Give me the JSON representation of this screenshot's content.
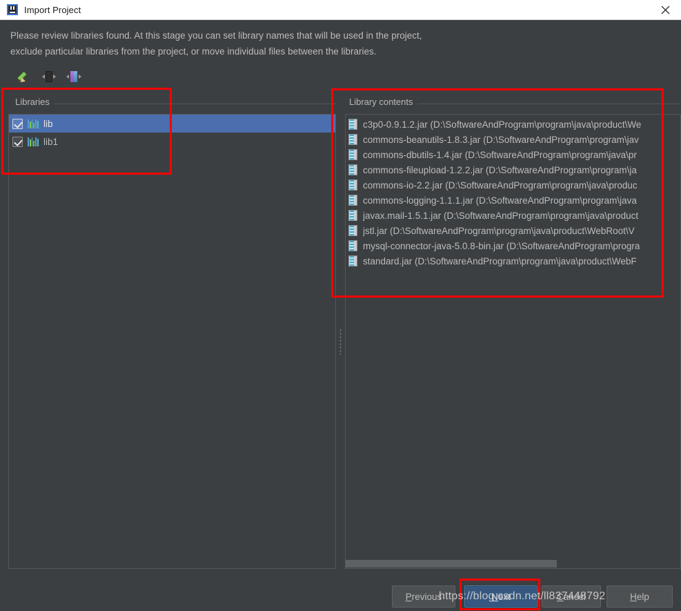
{
  "window": {
    "title": "Import Project",
    "icon": "intellij-idea-icon",
    "close_label": "✕"
  },
  "description": {
    "line1": "Please review libraries found. At this stage you can set library names that will be used in the project,",
    "line2": "exclude particular libraries from the project, or move individual files between the libraries."
  },
  "toolbar": {
    "items": [
      {
        "name": "rename-library-button",
        "icon": "pencil-icon"
      },
      {
        "name": "split-library-button",
        "icon": "split-icon"
      },
      {
        "name": "merge-libraries-button",
        "icon": "merge-icon"
      }
    ]
  },
  "libraries_panel": {
    "title": "Libraries",
    "items": [
      {
        "label": "lib",
        "checked": true,
        "selected": true
      },
      {
        "label": "lib1",
        "checked": true,
        "selected": false
      }
    ]
  },
  "contents_panel": {
    "title": "Library contents",
    "items": [
      "c3p0-0.9.1.2.jar (D:\\SoftwareAndProgram\\program\\java\\product\\We",
      "commons-beanutils-1.8.3.jar (D:\\SoftwareAndProgram\\program\\jav",
      "commons-dbutils-1.4.jar (D:\\SoftwareAndProgram\\program\\java\\pr",
      "commons-fileupload-1.2.2.jar (D:\\SoftwareAndProgram\\program\\ja",
      "commons-io-2.2.jar (D:\\SoftwareAndProgram\\program\\java\\produc",
      "commons-logging-1.1.1.jar (D:\\SoftwareAndProgram\\program\\java",
      "javax.mail-1.5.1.jar (D:\\SoftwareAndProgram\\program\\java\\product",
      "jstl.jar (D:\\SoftwareAndProgram\\program\\java\\product\\WebRoot\\V",
      "mysql-connector-java-5.0.8-bin.jar (D:\\SoftwareAndProgram\\progra",
      "standard.jar (D:\\SoftwareAndProgram\\program\\java\\product\\WebF"
    ]
  },
  "buttons": {
    "previous": "Previous",
    "next": "Next",
    "cancel": "Cancel",
    "help": "Help"
  },
  "watermark": "https://blog.csdn.net/ll837448792",
  "colors": {
    "background": "#3c3f41",
    "selection": "#4b6eaf",
    "primary_button": "#365880",
    "annotation": "#fe0000",
    "text": "#bcbcbc"
  }
}
